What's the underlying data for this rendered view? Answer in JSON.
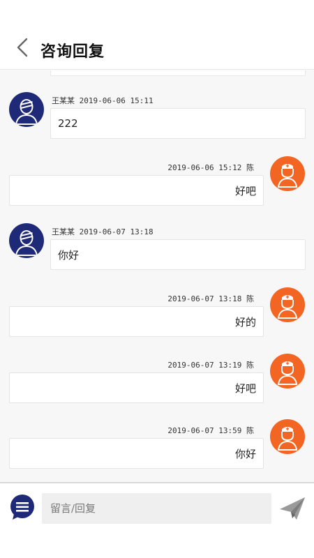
{
  "header": {
    "title": "咨询回复",
    "back_icon": "chevron-left-icon"
  },
  "messages": [
    {
      "side": "left",
      "sender": "王某某",
      "time": "2019-06-06 15:11",
      "text": "222",
      "avatar": "user-avatar-icon"
    },
    {
      "side": "right",
      "sender": "陈",
      "time": "2019-06-06 15:12",
      "text": "好吧",
      "avatar": "doctor-avatar-icon"
    },
    {
      "side": "left",
      "sender": "王某某",
      "time": "2019-06-07 13:18",
      "text": "你好",
      "avatar": "user-avatar-icon"
    },
    {
      "side": "right",
      "sender": "陈",
      "time": "2019-06-07 13:18",
      "text": "好的",
      "avatar": "doctor-avatar-icon"
    },
    {
      "side": "right",
      "sender": "陈",
      "time": "2019-06-07 13:19",
      "text": "好吧",
      "avatar": "doctor-avatar-icon"
    },
    {
      "side": "right",
      "sender": "陈",
      "time": "2019-06-07 13:59",
      "text": "你好",
      "avatar": "doctor-avatar-icon"
    }
  ],
  "footer": {
    "input_placeholder": "留言/回复",
    "input_value": "",
    "menu_icon": "menu-bubble-icon",
    "send_icon": "paper-plane-icon"
  },
  "colors": {
    "user_avatar": "#1e2a78",
    "staff_avatar": "#f26522",
    "chat_background": "#f7f7f7"
  }
}
